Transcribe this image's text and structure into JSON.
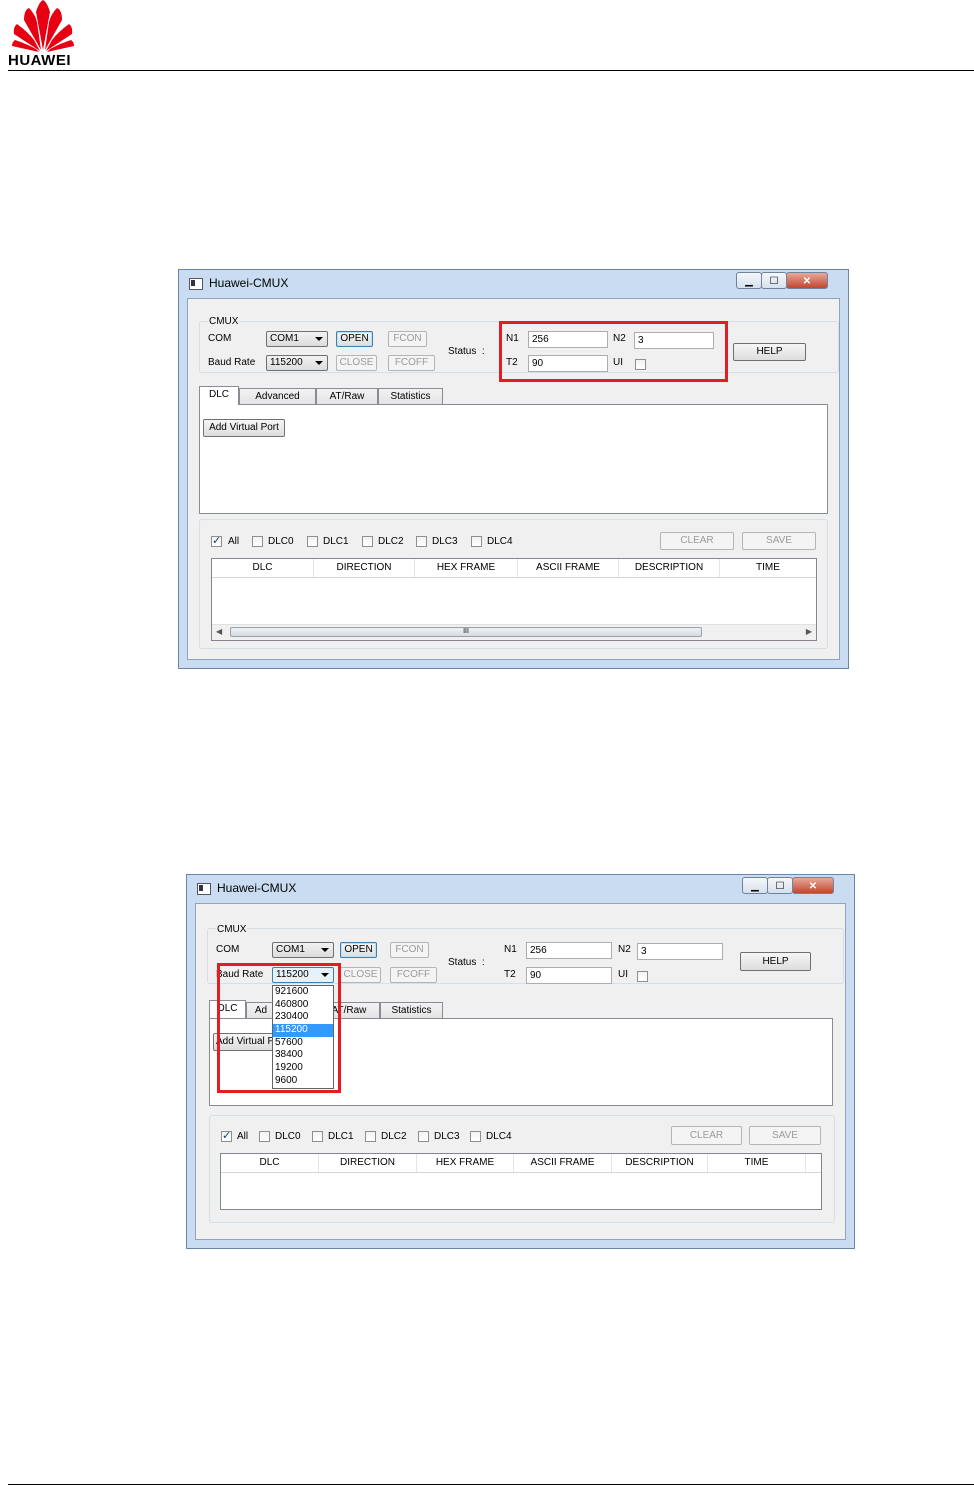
{
  "logo": {
    "text": "HUAWEI"
  },
  "windows": [
    {
      "title": "Huawei-CMUX",
      "caption": {
        "minimize": "▁",
        "maximize": "☐",
        "close": "✕"
      },
      "group_label": "CMUX",
      "com_label": "COM",
      "com_value": "COM1",
      "baud_label": "Baud Rate",
      "baud_value": "115200",
      "open": "OPEN",
      "fcon": "FCON",
      "close": "CLOSE",
      "fcoff": "FCOFF",
      "status_label": "Status  :",
      "n1_label": "N1",
      "n1": "256",
      "n2_label": "N2",
      "n2": "3",
      "t2_label": "T2",
      "t2": "90",
      "ui_label": "UI",
      "help": "HELP",
      "tabs": [
        "DLC",
        "Advanced",
        "AT/Raw",
        "Statistics"
      ],
      "add_virtual_port": "Add Virtual Port",
      "filters": [
        "All",
        "DLC0",
        "DLC1",
        "DLC2",
        "DLC3",
        "DLC4"
      ],
      "clear": "CLEAR",
      "save": "SAVE",
      "columns": [
        "DLC",
        "DIRECTION",
        "HEX FRAME",
        "ASCII FRAME",
        "DESCRIPTION",
        "TIME"
      ],
      "scroll_grip": "III"
    },
    {
      "title": "Huawei-CMUX",
      "caption": {
        "minimize": "▁",
        "maximize": "☐",
        "close": "✕"
      },
      "group_label": "CMUX",
      "com_label": "COM",
      "com_value": "COM1",
      "baud_label": "Baud Rate",
      "baud_value": "115200",
      "open": "OPEN",
      "fcon": "FCON",
      "close": "CLOSE",
      "fcoff": "FCOFF",
      "status_label": "Status  :",
      "n1_label": "N1",
      "n1": "256",
      "n2_label": "N2",
      "n2": "3",
      "t2_label": "T2",
      "t2": "90",
      "ui_label": "UI",
      "help": "HELP",
      "tabs": [
        "DLC",
        "Ad",
        "AT/Raw",
        "Statistics"
      ],
      "add_virtual_port": "Add Virtual P",
      "baud_options": [
        "921600",
        "460800",
        "230400",
        "115200",
        "57600",
        "38400",
        "19200",
        "9600"
      ],
      "baud_selected_index": 3,
      "filters": [
        "All",
        "DLC0",
        "DLC1",
        "DLC2",
        "DLC3",
        "DLC4"
      ],
      "clear": "CLEAR",
      "save": "SAVE",
      "columns": [
        "DLC",
        "DIRECTION",
        "HEX FRAME",
        "ASCII FRAME",
        "DESCRIPTION",
        "TIME"
      ]
    }
  ],
  "colors": {
    "highlight_box": "#e21d25",
    "selection": "#3399ff"
  }
}
